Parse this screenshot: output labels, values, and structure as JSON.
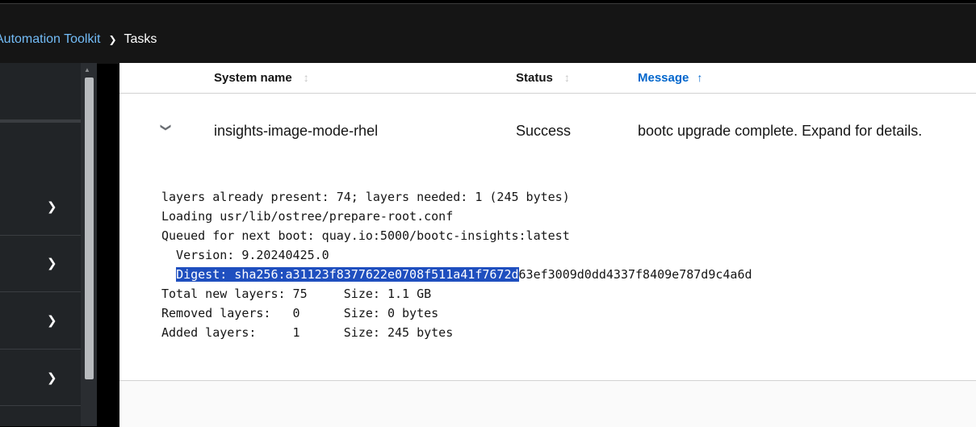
{
  "breadcrumb": {
    "parent": "Automation Toolkit",
    "current": "Tasks"
  },
  "table": {
    "columns": [
      {
        "label": "System name"
      },
      {
        "label": "Status"
      },
      {
        "label": "Message"
      }
    ],
    "row": {
      "system_name": "insights-image-mode-rhel",
      "status": "Success",
      "message": "bootc upgrade complete. Expand for details."
    },
    "details": {
      "line1": "layers already present: 74; layers needed: 1 (245 bytes)",
      "line2": "Loading usr/lib/ostree/prepare-root.conf",
      "line3": "Queued for next boot: quay.io:5000/bootc-insights:latest",
      "line4": "  Version: 9.20240425.0",
      "line5_indent": "  ",
      "line5_selected": "Digest: sha256:a31123f8377622e0708f511a41f7672d",
      "line5_rest": "63ef3009d0dd4337f8409e787d9c4a6d",
      "line6": "Total new layers: 75     Size: 1.1 GB",
      "line7": "Removed layers:   0      Size: 0 bytes",
      "line8": "Added layers:     1      Size: 245 bytes"
    }
  },
  "colors": {
    "accent": "#0066cc",
    "link": "#73bcf7",
    "selection": "#1f4fbf",
    "topbar": "#151515",
    "sidebar": "#212427"
  },
  "icons": {
    "breadcrumb_separator": "chevron-right-icon",
    "row_toggle": "chevron-down-icon",
    "sort": "sort-icon",
    "sidebar_expand": "chevron-right-icon"
  }
}
